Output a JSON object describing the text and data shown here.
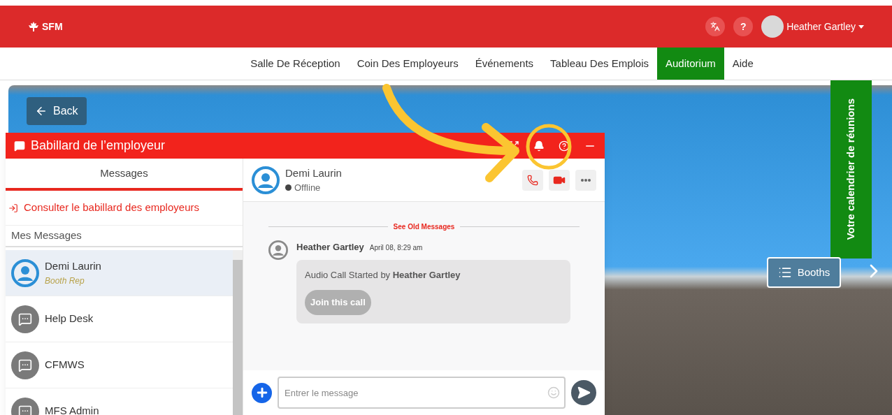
{
  "header": {
    "logo": "SFM",
    "user": {
      "name": "Heather Gartley"
    },
    "help_label": "?"
  },
  "nav": [
    {
      "label": "Salle De Réception",
      "selected": false
    },
    {
      "label": "Coin Des Employeurs",
      "selected": false
    },
    {
      "label": "Événements",
      "selected": false
    },
    {
      "label": "Tableau Des Emplois",
      "selected": false
    },
    {
      "label": "Auditorium",
      "selected": true
    },
    {
      "label": "Aide",
      "selected": false
    }
  ],
  "scene": {
    "back": "Back",
    "calendar": "Votre calendrier de réunions",
    "booths": "Booths"
  },
  "chat": {
    "title": "Babillard de l’employeur",
    "tabs": [
      {
        "label": "Messages",
        "selected": true
      }
    ],
    "board_link": "Consulter le babillard des employeurs",
    "section": "Mes Messages",
    "contacts": [
      {
        "name": "Demi Laurin",
        "role": "Booth Rep",
        "kind": "person",
        "selected": true
      },
      {
        "name": "Help Desk",
        "kind": "chat",
        "selected": false
      },
      {
        "name": "CFMWS",
        "kind": "chat",
        "selected": false
      },
      {
        "name": "MFS Admin",
        "kind": "chat",
        "selected": false
      }
    ],
    "conversation": {
      "name": "Demi Laurin",
      "status": "Offline",
      "online": false,
      "old_messages": "See Old Messages",
      "messages": [
        {
          "author": "Heather Gartley",
          "time": "April 08, 8:29 am",
          "text": "Audio Call Started by **Heather Gartley**",
          "action": "Join this call"
        }
      ],
      "input": {
        "placeholder": "Entrer le message"
      }
    }
  }
}
